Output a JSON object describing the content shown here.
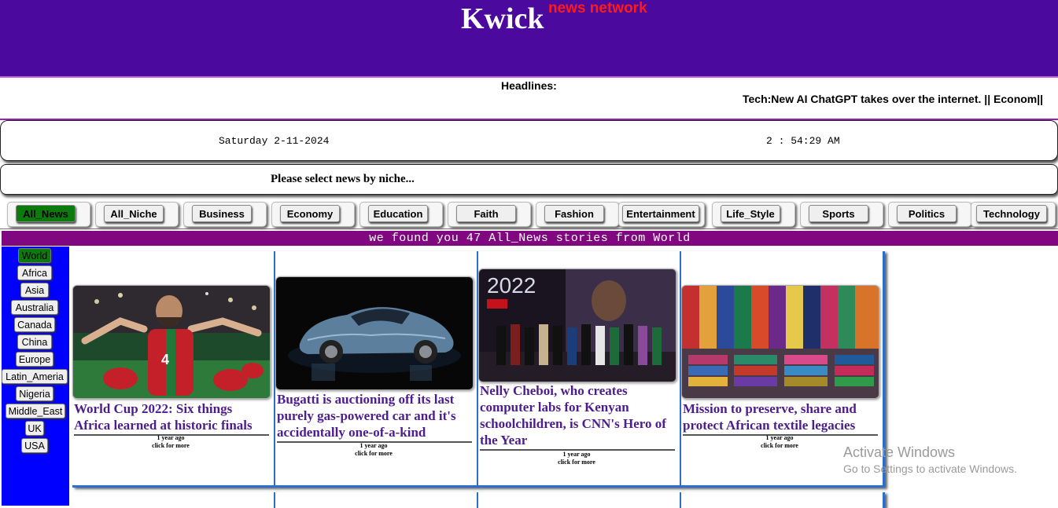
{
  "header": {
    "brand": "Kwick",
    "brand_sup": "news network"
  },
  "headlines": {
    "label": "Headlines:",
    "ticker": "Tech:New AI ChatGPT takes over the internet. || Econom||"
  },
  "datetime": {
    "date": "Saturday 2-11-2024",
    "time": "2 : 54:29 AM"
  },
  "niche_prompt": "Please select news by niche...",
  "tabs": [
    {
      "label": "All_News",
      "active": true
    },
    {
      "label": "All_Niche",
      "active": false
    },
    {
      "label": "Business",
      "active": false
    },
    {
      "label": "Economy",
      "active": false
    },
    {
      "label": "Education",
      "active": false
    },
    {
      "label": "Faith",
      "active": false
    },
    {
      "label": "Fashion",
      "active": false
    },
    {
      "label": "Entertainment",
      "active": false
    },
    {
      "label": "Life_Style",
      "active": false
    },
    {
      "label": "Sports",
      "active": false
    },
    {
      "label": "Politics",
      "active": false
    },
    {
      "label": "Technology",
      "active": false
    }
  ],
  "found_text": "we found you 47 All_News stories from World",
  "regions": [
    {
      "label": "World",
      "active": true
    },
    {
      "label": "Africa",
      "active": false
    },
    {
      "label": "Asia",
      "active": false
    },
    {
      "label": "Australia",
      "active": false
    },
    {
      "label": "Canada",
      "active": false
    },
    {
      "label": "China",
      "active": false
    },
    {
      "label": "Europe",
      "active": false
    },
    {
      "label": "Latin_Ameria",
      "active": false
    },
    {
      "label": "Nigeria",
      "active": false
    },
    {
      "label": "Middle_East",
      "active": false
    },
    {
      "label": "UK",
      "active": false
    },
    {
      "label": "USA",
      "active": false
    }
  ],
  "articles": [
    {
      "title": "World Cup 2022: Six things Africa learned at historic finals",
      "time": "1 year ago",
      "more": "click for more",
      "image": "football-celebration-image"
    },
    {
      "title": "Bugatti is auctioning off its last purely gas-powered car and it's accidentally one-of-a-kind",
      "time": "1 year ago",
      "more": "click for more",
      "image": "bugatti-car-image"
    },
    {
      "title": "Nelly Cheboi, who creates computer labs for Kenyan schoolchildren, is CNN's Hero of the Year",
      "time": "1 year ago",
      "more": "click for more",
      "image": "cnn-heroes-stage-image",
      "image_text": "2022"
    },
    {
      "title": "Mission to preserve, share and protect African textile legacies",
      "time": "1 year ago",
      "more": "click for more",
      "image": "african-textiles-image"
    }
  ],
  "watermark": {
    "line1": "Activate Windows",
    "line2": "Go to Settings to activate Windows."
  },
  "colors": {
    "masthead": "#4b099d",
    "accent_red": "#ff1a1a",
    "found_bar": "#800780",
    "region_bar": "#0000ff",
    "active_green": "#0d7a0d",
    "title_purple": "#4d1c8e"
  }
}
